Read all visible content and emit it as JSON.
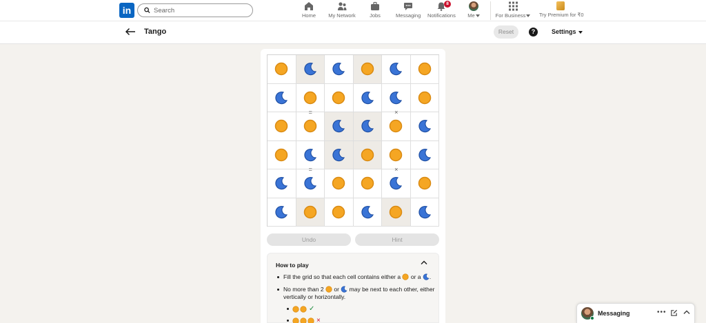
{
  "nav": {
    "logo": "in",
    "search_placeholder": "Search",
    "items": [
      {
        "label": "Home",
        "icon": "home-icon"
      },
      {
        "label": "My Network",
        "icon": "network-icon"
      },
      {
        "label": "Jobs",
        "icon": "jobs-icon"
      },
      {
        "label": "Messaging",
        "icon": "messaging-icon"
      },
      {
        "label": "Notifications",
        "icon": "bell-icon",
        "badge": "8"
      },
      {
        "label": "Me",
        "icon": "avatar"
      }
    ],
    "business": "For Business",
    "premium": "Try Premium for ₹0"
  },
  "subheader": {
    "title": "Tango",
    "reset": "Reset",
    "help": "?",
    "settings": "Settings"
  },
  "board": {
    "size": 6,
    "cells": [
      [
        "sun",
        "moon",
        "moon",
        "sun",
        "moon",
        "sun"
      ],
      [
        "moon",
        "sun",
        "sun",
        "moon",
        "moon",
        "sun"
      ],
      [
        "sun",
        "sun",
        "moon",
        "moon",
        "sun",
        "moon"
      ],
      [
        "sun",
        "moon",
        "moon",
        "sun",
        "sun",
        "moon"
      ],
      [
        "moon",
        "moon",
        "sun",
        "sun",
        "moon",
        "sun"
      ],
      [
        "moon",
        "sun",
        "sun",
        "moon",
        "sun",
        "moon"
      ]
    ],
    "locked": [
      [
        false,
        true,
        false,
        true,
        false,
        false
      ],
      [
        false,
        false,
        false,
        false,
        false,
        false
      ],
      [
        false,
        false,
        true,
        true,
        false,
        false
      ],
      [
        false,
        false,
        true,
        true,
        false,
        false
      ],
      [
        false,
        false,
        false,
        false,
        false,
        false
      ],
      [
        false,
        true,
        false,
        false,
        true,
        false
      ]
    ],
    "signs": [
      {
        "row": 1,
        "col": 1,
        "between": "below",
        "symbol": "="
      },
      {
        "row": 1,
        "col": 4,
        "between": "below",
        "symbol": "×"
      },
      {
        "row": 3,
        "col": 1,
        "between": "below",
        "symbol": "="
      },
      {
        "row": 3,
        "col": 4,
        "between": "below",
        "symbol": "×"
      }
    ]
  },
  "controls": {
    "undo": "Undo",
    "hint": "Hint"
  },
  "how_to_play": {
    "title": "How to play",
    "rule1_a": "Fill the grid so that each cell contains either a",
    "rule1_b": "or a",
    "rule1_c": ".",
    "rule2_a": "No more than 2",
    "rule2_b": "or",
    "rule2_c": "may be next to each other, either vertically or horizontally.",
    "example_ok": "✓",
    "example_bad": "×"
  },
  "messaging": {
    "title": "Messaging",
    "more": "•••"
  },
  "colors": {
    "sun": "#f5a623",
    "moon": "#3a74d6",
    "brand": "#0a66c2"
  }
}
